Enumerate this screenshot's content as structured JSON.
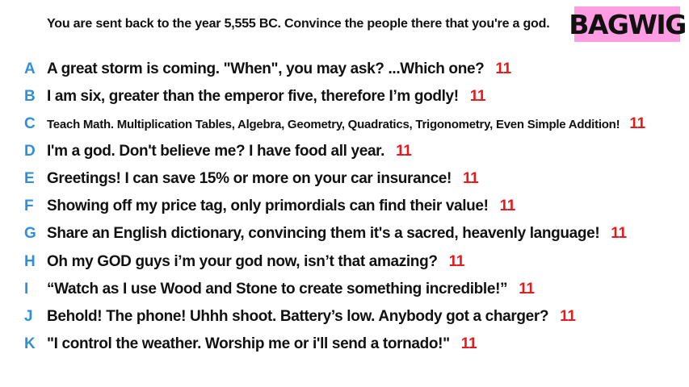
{
  "header": {
    "prompt": "You are sent back to the year 5,555 BC. Convince the people there that you're a god.",
    "logo": "BAGWIG"
  },
  "colors": {
    "letter": "#2f8fd8",
    "score": "#e41b1b",
    "logo_bg": "#ff9de3",
    "text": "#111111"
  },
  "answers": [
    {
      "letter": "A",
      "text": "A great storm is coming. \"When\", you may ask? ...Which one?",
      "score": "11"
    },
    {
      "letter": "B",
      "text": "I am six, greater than the emperor five, therefore I’m godly!",
      "score": "11"
    },
    {
      "letter": "C",
      "text": "Teach Math. Multiplication Tables, Algebra, Geometry, Quadratics, Trigonometry, Even Simple Addition!",
      "score": "11"
    },
    {
      "letter": "D",
      "text": "I'm a god. Don't believe me? I have food all year.",
      "score": "11"
    },
    {
      "letter": "E",
      "text": "Greetings! I can save 15% or more on your car insurance!",
      "score": "11"
    },
    {
      "letter": "F",
      "text": "Showing off my price tag, only primordials can find their value!",
      "score": "11"
    },
    {
      "letter": "G",
      "text": "Share an English dictionary, convincing them it's a sacred, heavenly language!",
      "score": "11"
    },
    {
      "letter": "H",
      "text": "Oh my GOD guys i’m your god now, isn’t that amazing?",
      "score": "11"
    },
    {
      "letter": "I",
      "text": "“Watch as I use Wood and Stone to create something incredible!”",
      "score": "11"
    },
    {
      "letter": "J",
      "text": "Behold! The phone! Uhhh shoot. Battery’s low. Anybody got a charger?",
      "score": "11"
    },
    {
      "letter": "K",
      "text": "\"I control the weather. Worship me or i'll send a tornado!\"",
      "score": "11"
    }
  ]
}
